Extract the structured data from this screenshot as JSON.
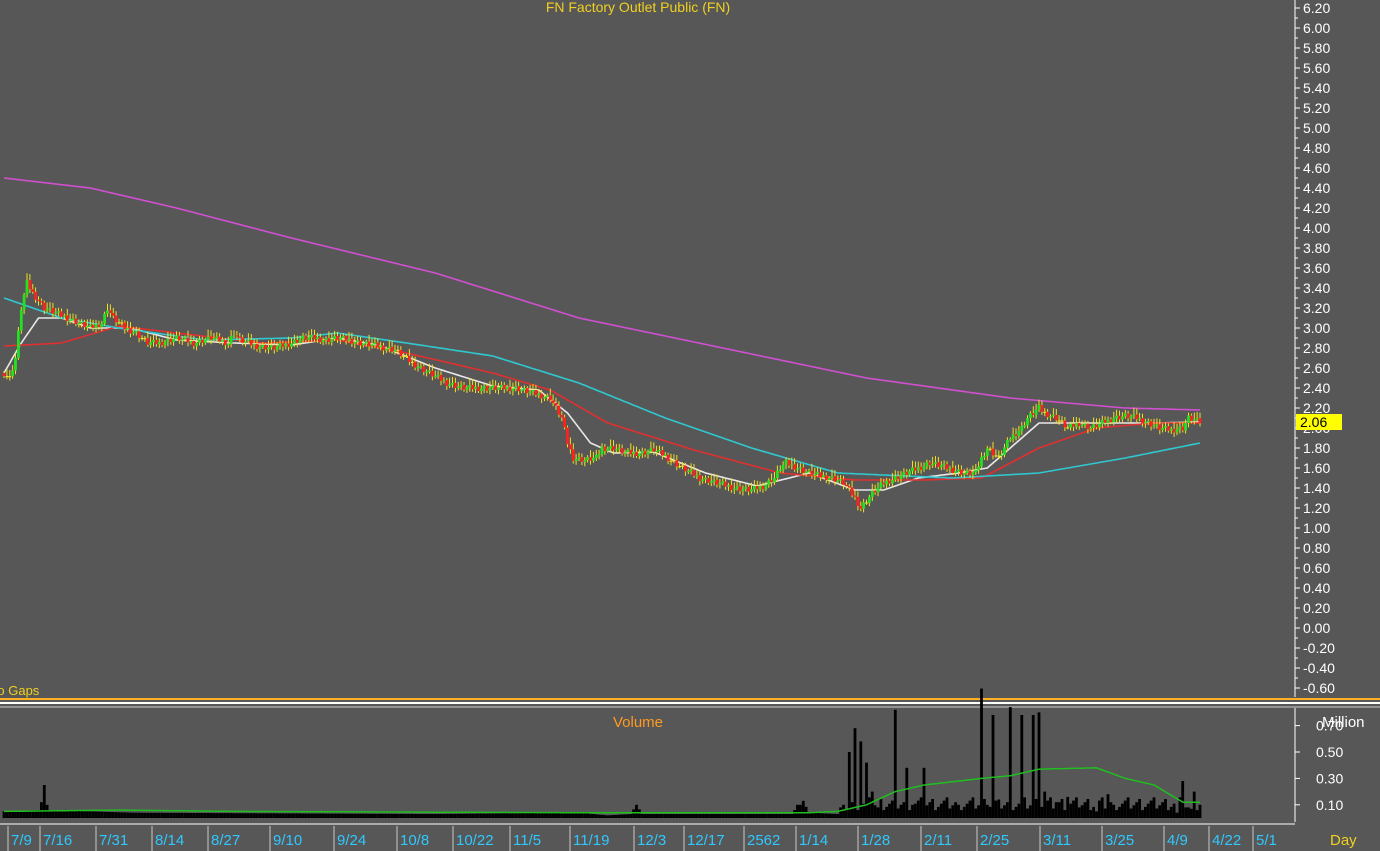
{
  "chart_data": {
    "type": "candlestick",
    "title": "FN Factory Outlet Public (FN)",
    "price_axis": {
      "ylim": [
        -0.6,
        6.2
      ],
      "tick_labels": [
        "6.20",
        "6.00",
        "5.80",
        "5.60",
        "5.40",
        "5.20",
        "5.00",
        "4.80",
        "4.60",
        "4.40",
        "4.20",
        "4.00",
        "3.80",
        "3.60",
        "3.40",
        "3.20",
        "3.00",
        "2.80",
        "2.60",
        "2.40",
        "2.20",
        "2.00",
        "1.80",
        "1.60",
        "1.40",
        "1.20",
        "1.00",
        "0.80",
        "0.60",
        "0.40",
        "0.20",
        "0.00",
        "-0.20",
        "-0.40",
        "-0.60"
      ]
    },
    "last_price_label": "2.06",
    "last_price": 2.06,
    "gaps_label": "No Gaps",
    "volume": {
      "title": "Volume",
      "unit": "Million",
      "ylim": [
        0,
        1.0
      ],
      "tick_labels": [
        "0.70",
        "0.50",
        "0.30",
        "0.10"
      ],
      "anchors": [
        [
          0,
          0.05
        ],
        [
          12,
          0.06
        ],
        [
          13,
          0.12
        ],
        [
          14,
          0.25
        ],
        [
          15,
          0.1
        ],
        [
          16,
          0.06
        ],
        [
          45,
          0.04
        ],
        [
          150,
          0.03
        ],
        [
          200,
          0.04
        ],
        [
          210,
          0.02
        ],
        [
          218,
          0.03
        ],
        [
          220,
          0.1
        ],
        [
          222,
          0.03
        ],
        [
          274,
          0.03
        ],
        [
          276,
          0.1
        ],
        [
          278,
          0.13
        ],
        [
          280,
          0.04
        ],
        [
          290,
          0.03
        ],
        [
          294,
          0.5
        ],
        [
          296,
          0.68
        ],
        [
          298,
          0.58
        ],
        [
          300,
          0.42
        ],
        [
          302,
          0.2
        ],
        [
          304,
          0.08
        ],
        [
          310,
          0.82
        ],
        [
          312,
          0.1
        ],
        [
          314,
          0.38
        ],
        [
          316,
          0.1
        ],
        [
          320,
          0.38
        ],
        [
          322,
          0.12
        ],
        [
          332,
          0.1
        ],
        [
          340,
          0.98
        ],
        [
          342,
          0.1
        ],
        [
          344,
          0.78
        ],
        [
          346,
          0.14
        ],
        [
          350,
          0.84
        ],
        [
          354,
          0.78
        ],
        [
          358,
          0.78
        ],
        [
          360,
          0.8
        ],
        [
          362,
          0.2
        ],
        [
          366,
          0.12
        ],
        [
          370,
          0.16
        ],
        [
          374,
          0.08
        ],
        [
          380,
          0.05
        ],
        [
          384,
          0.18
        ],
        [
          386,
          0.1
        ],
        [
          396,
          0.06
        ],
        [
          408,
          0.04
        ],
        [
          410,
          0.28
        ],
        [
          412,
          0.08
        ],
        [
          414,
          0.2
        ],
        [
          416,
          0.1
        ],
        [
          420,
          0.08
        ]
      ]
    },
    "x_axis": {
      "label": "Day",
      "date_labels": [
        "7/9",
        "7/16",
        "7/31",
        "8/14",
        "8/27",
        "9/10",
        "9/24",
        "10/8",
        "10/22",
        "11/5",
        "11/19",
        "12/3",
        "12/17",
        "2562",
        "1/14",
        "1/28",
        "2/11",
        "2/25",
        "3/11",
        "3/25",
        "4/9",
        "4/22",
        "5/1"
      ]
    },
    "close_anchors": [
      [
        0,
        2.55
      ],
      [
        2,
        2.5
      ],
      [
        4,
        2.7
      ],
      [
        6,
        3.2
      ],
      [
        8,
        3.45
      ],
      [
        10,
        3.35
      ],
      [
        14,
        3.2
      ],
      [
        18,
        3.15
      ],
      [
        22,
        3.1
      ],
      [
        26,
        3.05
      ],
      [
        30,
        3.0
      ],
      [
        34,
        3.05
      ],
      [
        36,
        3.2
      ],
      [
        38,
        3.1
      ],
      [
        42,
        3.0
      ],
      [
        46,
        2.95
      ],
      [
        50,
        2.85
      ],
      [
        54,
        2.85
      ],
      [
        60,
        2.9
      ],
      [
        66,
        2.85
      ],
      [
        72,
        2.9
      ],
      [
        78,
        2.85
      ],
      [
        80,
        2.95
      ],
      [
        82,
        2.88
      ],
      [
        88,
        2.82
      ],
      [
        94,
        2.8
      ],
      [
        100,
        2.85
      ],
      [
        104,
        2.9
      ],
      [
        108,
        2.9
      ],
      [
        112,
        2.88
      ],
      [
        116,
        2.9
      ],
      [
        120,
        2.88
      ],
      [
        124,
        2.85
      ],
      [
        130,
        2.82
      ],
      [
        136,
        2.78
      ],
      [
        142,
        2.65
      ],
      [
        148,
        2.55
      ],
      [
        154,
        2.45
      ],
      [
        160,
        2.4
      ],
      [
        166,
        2.4
      ],
      [
        172,
        2.4
      ],
      [
        178,
        2.4
      ],
      [
        184,
        2.35
      ],
      [
        190,
        2.3
      ],
      [
        194,
        2.1
      ],
      [
        196,
        1.85
      ],
      [
        198,
        1.7
      ],
      [
        202,
        1.68
      ],
      [
        206,
        1.7
      ],
      [
        208,
        1.8
      ],
      [
        212,
        1.8
      ],
      [
        216,
        1.75
      ],
      [
        222,
        1.75
      ],
      [
        226,
        1.78
      ],
      [
        230,
        1.72
      ],
      [
        236,
        1.6
      ],
      [
        242,
        1.5
      ],
      [
        248,
        1.45
      ],
      [
        254,
        1.4
      ],
      [
        260,
        1.38
      ],
      [
        264,
        1.42
      ],
      [
        268,
        1.5
      ],
      [
        270,
        1.6
      ],
      [
        272,
        1.65
      ],
      [
        276,
        1.6
      ],
      [
        280,
        1.55
      ],
      [
        284,
        1.52
      ],
      [
        288,
        1.5
      ],
      [
        292,
        1.45
      ],
      [
        296,
        1.3
      ],
      [
        298,
        1.2
      ],
      [
        302,
        1.35
      ],
      [
        306,
        1.45
      ],
      [
        310,
        1.5
      ],
      [
        314,
        1.55
      ],
      [
        318,
        1.6
      ],
      [
        322,
        1.65
      ],
      [
        326,
        1.62
      ],
      [
        330,
        1.58
      ],
      [
        334,
        1.55
      ],
      [
        338,
        1.55
      ],
      [
        340,
        1.7
      ],
      [
        342,
        1.8
      ],
      [
        344,
        1.75
      ],
      [
        346,
        1.7
      ],
      [
        348,
        1.8
      ],
      [
        350,
        1.9
      ],
      [
        352,
        1.95
      ],
      [
        354,
        2.0
      ],
      [
        356,
        2.1
      ],
      [
        358,
        2.15
      ],
      [
        360,
        2.2
      ],
      [
        362,
        2.15
      ],
      [
        366,
        2.1
      ],
      [
        370,
        2.0
      ],
      [
        374,
        2.05
      ],
      [
        378,
        2.0
      ],
      [
        382,
        2.05
      ],
      [
        386,
        2.1
      ],
      [
        390,
        2.12
      ],
      [
        394,
        2.1
      ],
      [
        398,
        2.05
      ],
      [
        402,
        2.0
      ],
      [
        406,
        1.98
      ],
      [
        410,
        2.0
      ],
      [
        412,
        2.1
      ],
      [
        416,
        2.06
      ]
    ],
    "series": [
      {
        "color": "#e8e8e8",
        "anchors": [
          [
            0,
            2.55
          ],
          [
            6,
            2.85
          ],
          [
            12,
            3.1
          ],
          [
            20,
            3.1
          ],
          [
            30,
            3.0
          ],
          [
            44,
            3.0
          ],
          [
            60,
            2.88
          ],
          [
            80,
            2.85
          ],
          [
            100,
            2.83
          ],
          [
            116,
            2.9
          ],
          [
            130,
            2.83
          ],
          [
            150,
            2.6
          ],
          [
            170,
            2.42
          ],
          [
            186,
            2.38
          ],
          [
            196,
            2.15
          ],
          [
            204,
            1.85
          ],
          [
            212,
            1.75
          ],
          [
            226,
            1.76
          ],
          [
            244,
            1.55
          ],
          [
            262,
            1.42
          ],
          [
            280,
            1.55
          ],
          [
            296,
            1.38
          ],
          [
            306,
            1.38
          ],
          [
            318,
            1.5
          ],
          [
            332,
            1.55
          ],
          [
            342,
            1.6
          ],
          [
            352,
            1.85
          ],
          [
            360,
            2.05
          ],
          [
            370,
            2.05
          ],
          [
            386,
            2.05
          ],
          [
            400,
            2.05
          ],
          [
            416,
            2.06
          ]
        ]
      },
      {
        "color": "#e03030",
        "anchors": [
          [
            0,
            2.82
          ],
          [
            20,
            2.85
          ],
          [
            40,
            3.02
          ],
          [
            60,
            2.95
          ],
          [
            90,
            2.85
          ],
          [
            116,
            2.88
          ],
          [
            140,
            2.75
          ],
          [
            170,
            2.55
          ],
          [
            190,
            2.38
          ],
          [
            210,
            2.05
          ],
          [
            240,
            1.78
          ],
          [
            270,
            1.55
          ],
          [
            296,
            1.48
          ],
          [
            320,
            1.48
          ],
          [
            340,
            1.5
          ],
          [
            360,
            1.8
          ],
          [
            380,
            2.0
          ],
          [
            400,
            2.05
          ],
          [
            416,
            2.05
          ]
        ]
      },
      {
        "color": "#30c8d0",
        "anchors": [
          [
            0,
            3.3
          ],
          [
            20,
            3.1
          ],
          [
            40,
            3.0
          ],
          [
            70,
            2.88
          ],
          [
            100,
            2.9
          ],
          [
            116,
            2.95
          ],
          [
            140,
            2.85
          ],
          [
            170,
            2.72
          ],
          [
            200,
            2.45
          ],
          [
            230,
            2.1
          ],
          [
            260,
            1.8
          ],
          [
            290,
            1.55
          ],
          [
            330,
            1.5
          ],
          [
            360,
            1.55
          ],
          [
            390,
            1.7
          ],
          [
            416,
            1.85
          ]
        ]
      },
      {
        "color": "#d050d0",
        "anchors": [
          [
            0,
            4.5
          ],
          [
            30,
            4.4
          ],
          [
            60,
            4.2
          ],
          [
            100,
            3.9
          ],
          [
            150,
            3.55
          ],
          [
            200,
            3.1
          ],
          [
            250,
            2.8
          ],
          [
            300,
            2.5
          ],
          [
            350,
            2.3
          ],
          [
            390,
            2.2
          ],
          [
            416,
            2.18
          ]
        ]
      }
    ],
    "volume_ma": {
      "color": "#1fbf1f",
      "anchors": [
        [
          0,
          0.05
        ],
        [
          40,
          0.06
        ],
        [
          80,
          0.05
        ],
        [
          200,
          0.04
        ],
        [
          280,
          0.04
        ],
        [
          290,
          0.05
        ],
        [
          300,
          0.1
        ],
        [
          310,
          0.2
        ],
        [
          320,
          0.25
        ],
        [
          340,
          0.3
        ],
        [
          350,
          0.32
        ],
        [
          360,
          0.37
        ],
        [
          380,
          0.38
        ],
        [
          390,
          0.3
        ],
        [
          400,
          0.25
        ],
        [
          410,
          0.12
        ],
        [
          416,
          0.12
        ]
      ]
    }
  }
}
